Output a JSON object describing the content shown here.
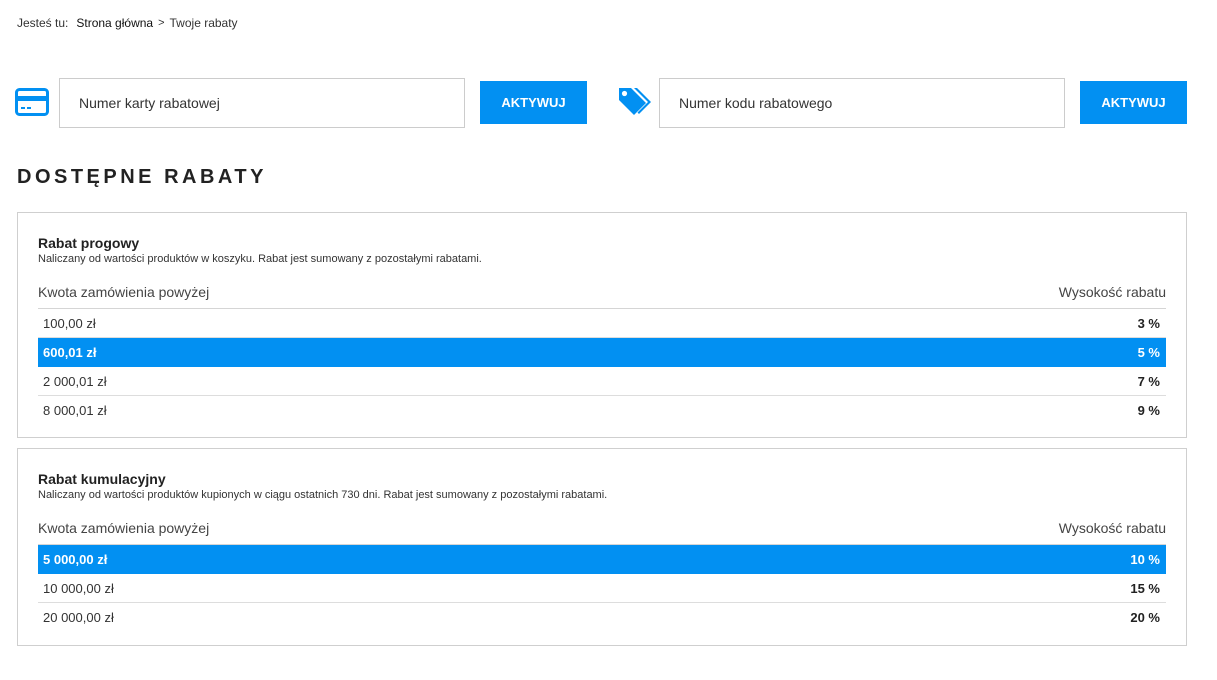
{
  "breadcrumb": {
    "prefix": "Jesteś tu:",
    "home": "Strona główna",
    "separator": ">",
    "current": "Twoje rabaty"
  },
  "activation": {
    "card": {
      "icon": "credit-card-icon",
      "placeholder": "Numer karty rabatowej",
      "button": "AKTYWUJ"
    },
    "code": {
      "icon": "tags-icon",
      "placeholder": "Numer kodu rabatowego",
      "button": "AKTYWUJ"
    }
  },
  "colors": {
    "accent": "#0290f2",
    "border": "#cfcfcf",
    "text": "#333333"
  },
  "section_title": "DOSTĘPNE RABATY",
  "discounts": [
    {
      "title": "Rabat progowy",
      "description": "Naliczany od wartości produktów w koszyku. Rabat jest sumowany z pozostałymi rabatami.",
      "col_amount": "Kwota zamówienia powyżej",
      "col_rate": "Wysokość rabatu",
      "rows": [
        {
          "amount": "100,00 zł",
          "rate": "3 %",
          "active": false
        },
        {
          "amount": "600,01 zł",
          "rate": "5 %",
          "active": true
        },
        {
          "amount": "2 000,01 zł",
          "rate": "7 %",
          "active": false
        },
        {
          "amount": "8 000,01 zł",
          "rate": "9 %",
          "active": false
        }
      ]
    },
    {
      "title": "Rabat kumulacyjny",
      "description": "Naliczany od wartości produktów kupionych w ciągu ostatnich 730 dni. Rabat jest sumowany z pozostałymi rabatami.",
      "col_amount": "Kwota zamówienia powyżej",
      "col_rate": "Wysokość rabatu",
      "rows": [
        {
          "amount": "5 000,00 zł",
          "rate": "10 %",
          "active": true
        },
        {
          "amount": "10 000,00 zł",
          "rate": "15 %",
          "active": false
        },
        {
          "amount": "20 000,00 zł",
          "rate": "20 %",
          "active": false
        }
      ]
    }
  ]
}
